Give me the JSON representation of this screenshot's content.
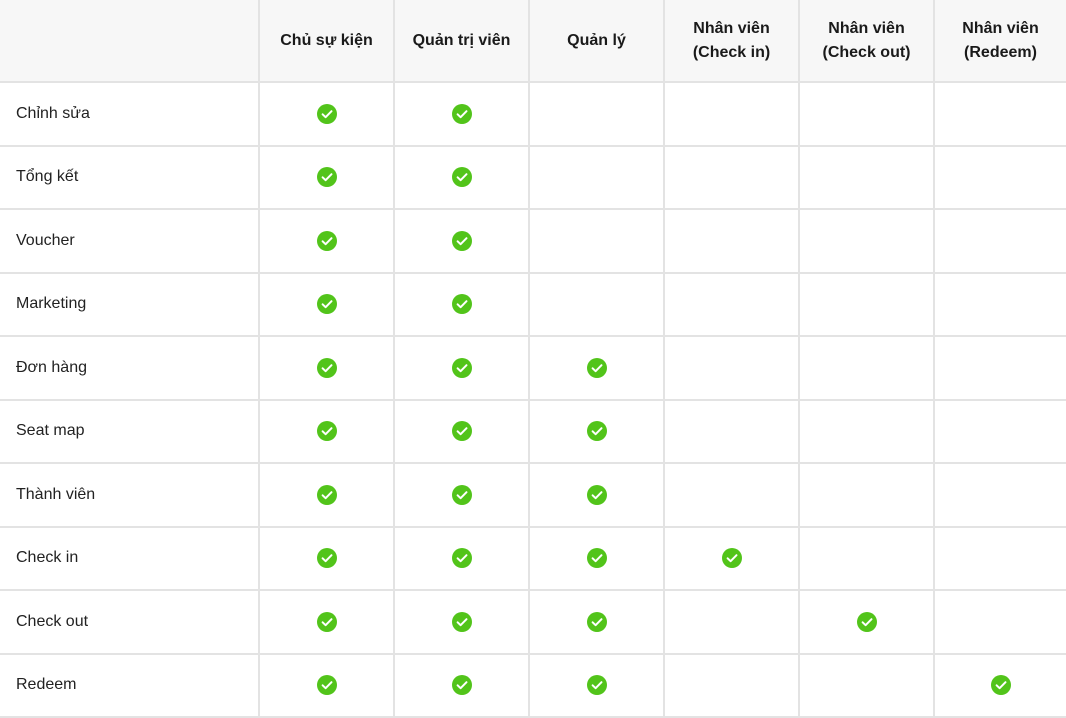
{
  "colors": {
    "check_fill": "#52c41a",
    "check_mark": "#ffffff",
    "header_bg": "#f7f7f7",
    "grid_line": "#e3e3e3"
  },
  "table": {
    "corner_label": "",
    "headers": [
      {
        "line1": "Chủ sự kiện",
        "line2": ""
      },
      {
        "line1": "Quản trị viên",
        "line2": ""
      },
      {
        "line1": "Quản lý",
        "line2": ""
      },
      {
        "line1": "Nhân viên",
        "line2": "(Check in)"
      },
      {
        "line1": "Nhân viên",
        "line2": "(Check out)"
      },
      {
        "line1": "Nhân viên",
        "line2": "(Redeem)"
      }
    ],
    "icon": "check-circle-icon",
    "rows": [
      {
        "feature": "Chỉnh sửa",
        "permissions": [
          true,
          true,
          false,
          false,
          false,
          false
        ]
      },
      {
        "feature": "Tổng kết",
        "permissions": [
          true,
          true,
          false,
          false,
          false,
          false
        ]
      },
      {
        "feature": "Voucher",
        "permissions": [
          true,
          true,
          false,
          false,
          false,
          false
        ]
      },
      {
        "feature": "Marketing",
        "permissions": [
          true,
          true,
          false,
          false,
          false,
          false
        ]
      },
      {
        "feature": "Đơn hàng",
        "permissions": [
          true,
          true,
          true,
          false,
          false,
          false
        ]
      },
      {
        "feature": "Seat map",
        "permissions": [
          true,
          true,
          true,
          false,
          false,
          false
        ]
      },
      {
        "feature": "Thành viên",
        "permissions": [
          true,
          true,
          true,
          false,
          false,
          false
        ]
      },
      {
        "feature": "Check in",
        "permissions": [
          true,
          true,
          true,
          true,
          false,
          false
        ]
      },
      {
        "feature": "Check out",
        "permissions": [
          true,
          true,
          true,
          false,
          true,
          false
        ]
      },
      {
        "feature": "Redeem",
        "permissions": [
          true,
          true,
          true,
          false,
          false,
          true
        ]
      }
    ]
  }
}
